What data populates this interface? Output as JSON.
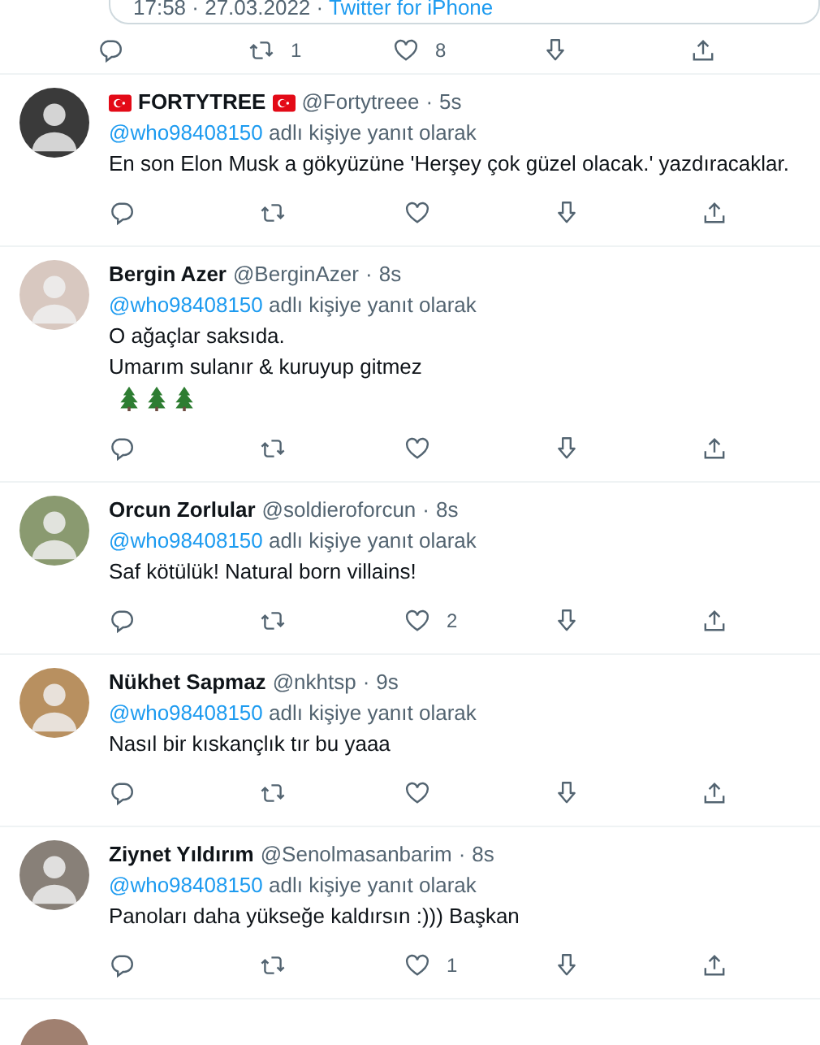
{
  "quoted_card": {
    "meta": "17:58 · 27.03.2022 ·",
    "source": "Twitter for iPhone"
  },
  "main_actions": [
    {
      "kind": "reply"
    },
    {
      "kind": "retweet",
      "count": "1"
    },
    {
      "kind": "like",
      "count": "8"
    },
    {
      "kind": "save"
    },
    {
      "kind": "share"
    }
  ],
  "replies": [
    {
      "name_parts": [
        {
          "kind": "flag"
        },
        {
          "kind": "text",
          "text": "FORTYTREE"
        },
        {
          "kind": "flag"
        }
      ],
      "handle": "@Fortytreee",
      "separator": "·",
      "time": "5s",
      "reply_to": "@who98408150",
      "reply_label": "adlı kişiye yanıt olarak",
      "lines": [
        "En son Elon Musk a gökyüzüne 'Herşey çok güzel olacak.' yazdıracaklar."
      ],
      "actions": [
        {
          "kind": "reply"
        },
        {
          "kind": "retweet"
        },
        {
          "kind": "like"
        },
        {
          "kind": "save"
        },
        {
          "kind": "share"
        }
      ]
    },
    {
      "name_parts": [
        {
          "kind": "text",
          "text": "Bergin Azer"
        }
      ],
      "handle": "@BerginAzer",
      "separator": "·",
      "time": "8s",
      "reply_to": "@who98408150",
      "reply_label": "adlı kişiye yanıt olarak",
      "lines": [
        "O ağaçlar saksıda.",
        "Umarım sulanır & kuruyup gitmez"
      ],
      "emoji": [
        {
          "kind": "tree"
        },
        {
          "kind": "tree"
        },
        {
          "kind": "tree"
        }
      ],
      "actions": [
        {
          "kind": "reply"
        },
        {
          "kind": "retweet"
        },
        {
          "kind": "like"
        },
        {
          "kind": "save"
        },
        {
          "kind": "share"
        }
      ]
    },
    {
      "name_parts": [
        {
          "kind": "text",
          "text": "Orcun Zorlular"
        }
      ],
      "handle": "@soldieroforcun",
      "separator": "·",
      "time": "8s",
      "reply_to": "@who98408150",
      "reply_label": "adlı kişiye yanıt olarak",
      "lines": [
        "Saf kötülük! Natural born villains!"
      ],
      "actions": [
        {
          "kind": "reply"
        },
        {
          "kind": "retweet"
        },
        {
          "kind": "like",
          "count": "2"
        },
        {
          "kind": "save"
        },
        {
          "kind": "share"
        }
      ]
    },
    {
      "name_parts": [
        {
          "kind": "text",
          "text": "Nükhet Sapmaz"
        }
      ],
      "handle": "@nkhtsp",
      "separator": "·",
      "time": "9s",
      "reply_to": "@who98408150",
      "reply_label": "adlı kişiye yanıt olarak",
      "lines": [
        "Nasıl bir kıskançlık tır bu yaaa"
      ],
      "actions": [
        {
          "kind": "reply"
        },
        {
          "kind": "retweet"
        },
        {
          "kind": "like"
        },
        {
          "kind": "save"
        },
        {
          "kind": "share"
        }
      ]
    },
    {
      "name_parts": [
        {
          "kind": "text",
          "text": "Ziynet Yıldırım"
        }
      ],
      "handle": "@Senolmasanbarim",
      "separator": "·",
      "time": "8s",
      "reply_to": "@who98408150",
      "reply_label": "adlı kişiye yanıt olarak",
      "lines": [
        "Panoları daha yükseğe kaldırsın :))) Başkan"
      ],
      "actions": [
        {
          "kind": "reply"
        },
        {
          "kind": "retweet"
        },
        {
          "kind": "like",
          "count": "1"
        },
        {
          "kind": "save"
        },
        {
          "kind": "share"
        }
      ]
    }
  ]
}
